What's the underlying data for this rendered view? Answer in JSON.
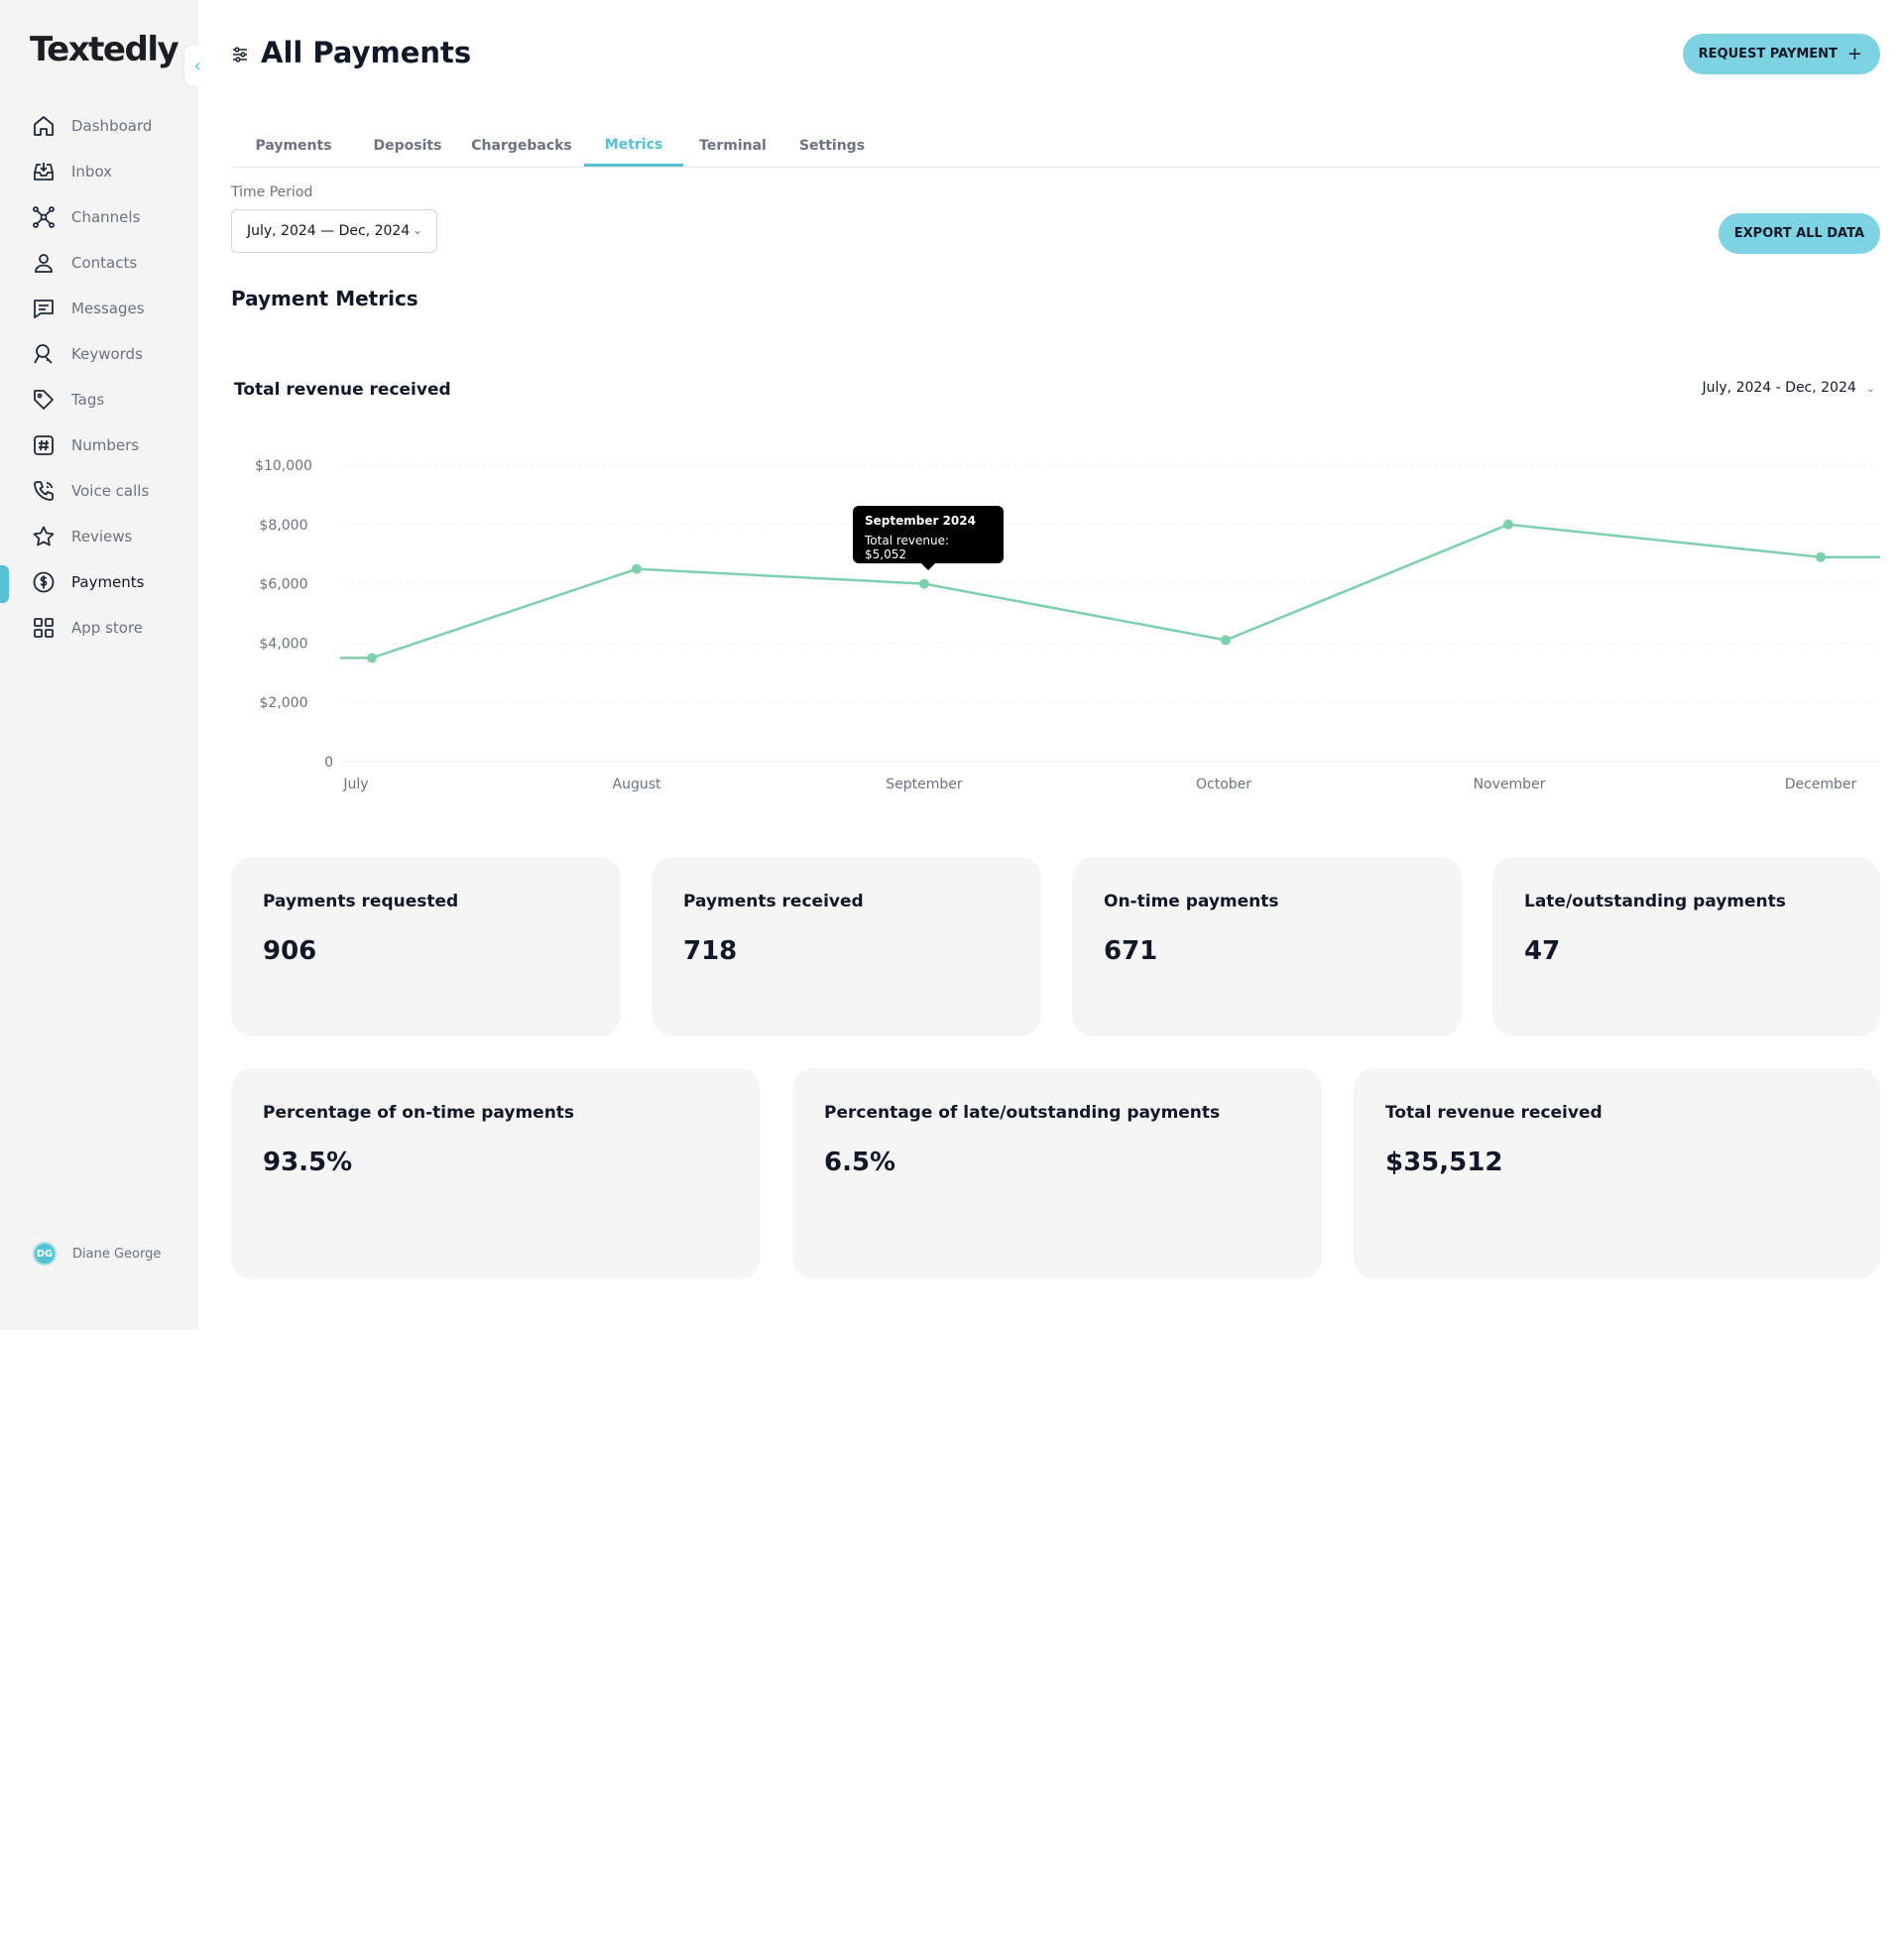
{
  "app": {
    "logo": "Textedly"
  },
  "sidebar": {
    "items": [
      {
        "label": "Dashboard",
        "icon": "home-icon"
      },
      {
        "label": "Inbox",
        "icon": "inbox-icon"
      },
      {
        "label": "Channels",
        "icon": "channels-icon"
      },
      {
        "label": "Contacts",
        "icon": "user-icon"
      },
      {
        "label": "Messages",
        "icon": "message-icon"
      },
      {
        "label": "Keywords",
        "icon": "keyword-icon"
      },
      {
        "label": "Tags",
        "icon": "tag-icon"
      },
      {
        "label": "Numbers",
        "icon": "hash-icon"
      },
      {
        "label": "Voice calls",
        "icon": "phone-icon"
      },
      {
        "label": "Reviews",
        "icon": "star-icon"
      },
      {
        "label": "Payments",
        "icon": "dollar-icon",
        "active": true
      },
      {
        "label": "App store",
        "icon": "grid-icon"
      }
    ],
    "user": {
      "initials": "DG",
      "name": "Diane George"
    }
  },
  "header": {
    "title": "All Payments",
    "request_button": "REQUEST PAYMENT"
  },
  "tabs": [
    {
      "label": "Payments"
    },
    {
      "label": "Deposits"
    },
    {
      "label": "Chargebacks"
    },
    {
      "label": "Metrics",
      "active": true
    },
    {
      "label": "Terminal"
    },
    {
      "label": "Settings"
    }
  ],
  "filters": {
    "time_period_label": "Time Period",
    "time_period_value": "July, 2024 — Dec, 2024",
    "export_button": "EXPORT ALL DATA"
  },
  "section_title": "Payment Metrics",
  "chart": {
    "title": "Total revenue received",
    "range_label": "July, 2024 - Dec, 2024",
    "tooltip": {
      "title": "September 2024",
      "value": "Total revenue: $5,052"
    }
  },
  "chart_data": {
    "type": "line",
    "title": "Total revenue received",
    "categories": [
      "July",
      "August",
      "September",
      "October",
      "November",
      "December"
    ],
    "values": [
      3500,
      6500,
      6000,
      4100,
      8000,
      6900
    ],
    "ytick_labels": [
      "0",
      "$2,000",
      "$4,000",
      "$6,000",
      "$8,000",
      "$10,000"
    ],
    "ylim": [
      0,
      10000
    ],
    "grid": true,
    "color": "#7ecfac"
  },
  "cards_row1": [
    {
      "label": "Payments requested",
      "value": "906"
    },
    {
      "label": "Payments received",
      "value": "718"
    },
    {
      "label": "On-time payments",
      "value": "671"
    },
    {
      "label": "Late/outstanding payments",
      "value": "47"
    }
  ],
  "cards_row2": [
    {
      "label": "Percentage of on-time payments",
      "value": "93.5%"
    },
    {
      "label": "Percentage of late/outstanding payments",
      "value": "6.5%"
    },
    {
      "label": "Total revenue received",
      "value": "$35,512"
    }
  ]
}
